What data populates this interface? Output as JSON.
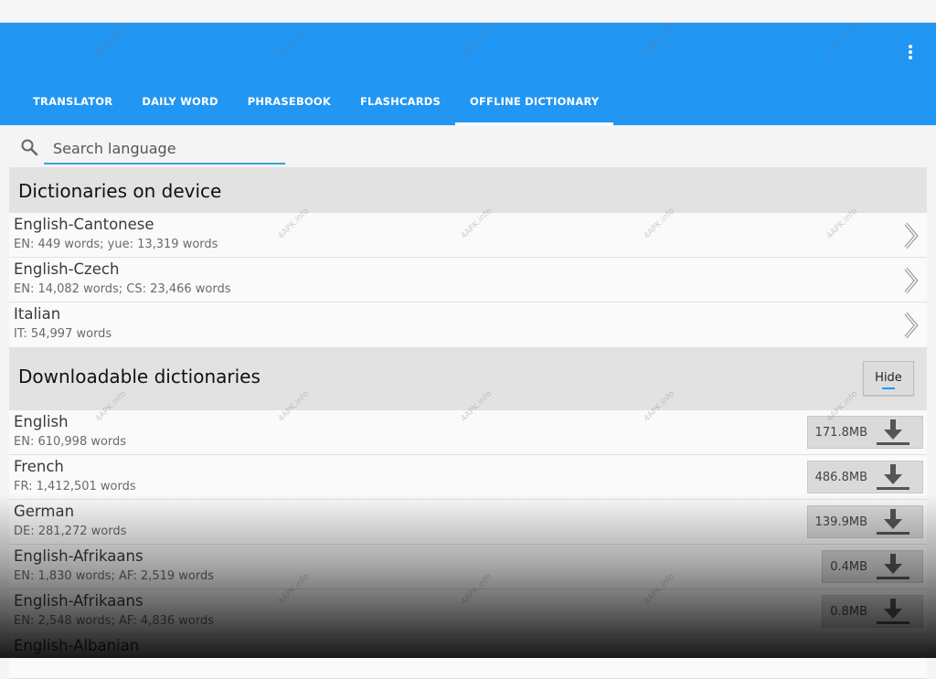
{
  "tabs": [
    {
      "label": "TRANSLATOR"
    },
    {
      "label": "DAILY WORD"
    },
    {
      "label": "PHRASEBOOK"
    },
    {
      "label": "FLASHCARDS"
    },
    {
      "label": "OFFLINE DICTIONARY"
    }
  ],
  "active_tab": "OFFLINE DICTIONARY",
  "search": {
    "placeholder": "Search language",
    "value": ""
  },
  "on_device": {
    "title": "Dictionaries on device",
    "items": [
      {
        "name": "English-Cantonese",
        "sub": "EN: 449 words; yue: 13,319 words"
      },
      {
        "name": "English-Czech",
        "sub": "EN: 14,082 words; CS: 23,466 words"
      },
      {
        "name": "Italian",
        "sub": "IT: 54,997 words"
      }
    ]
  },
  "downloadable": {
    "title": "Downloadable dictionaries",
    "hide_label": "Hide",
    "items": [
      {
        "name": "English",
        "sub": "EN: 610,998 words",
        "size": "171.8MB"
      },
      {
        "name": "French",
        "sub": "FR: 1,412,501 words",
        "size": "486.8MB"
      },
      {
        "name": "German",
        "sub": "DE: 281,272 words",
        "size": "139.9MB"
      },
      {
        "name": "English-Afrikaans",
        "sub": "EN: 1,830 words; AF: 2,519 words",
        "size": "0.4MB"
      },
      {
        "name": "English-Afrikaans",
        "sub": "EN: 2,548 words; AF: 4,836 words",
        "size": "0.8MB"
      },
      {
        "name": "English-Albanian",
        "sub": "",
        "size": ""
      }
    ]
  },
  "watermark_text": "4APK.info",
  "colors": {
    "accent": "#2196f3",
    "statusbar": "#f7f7f7",
    "section_bg": "#e2e2e2"
  },
  "icons": [
    "overflow-menu-icon",
    "search-icon",
    "chevron-right-icon",
    "download-icon"
  ]
}
